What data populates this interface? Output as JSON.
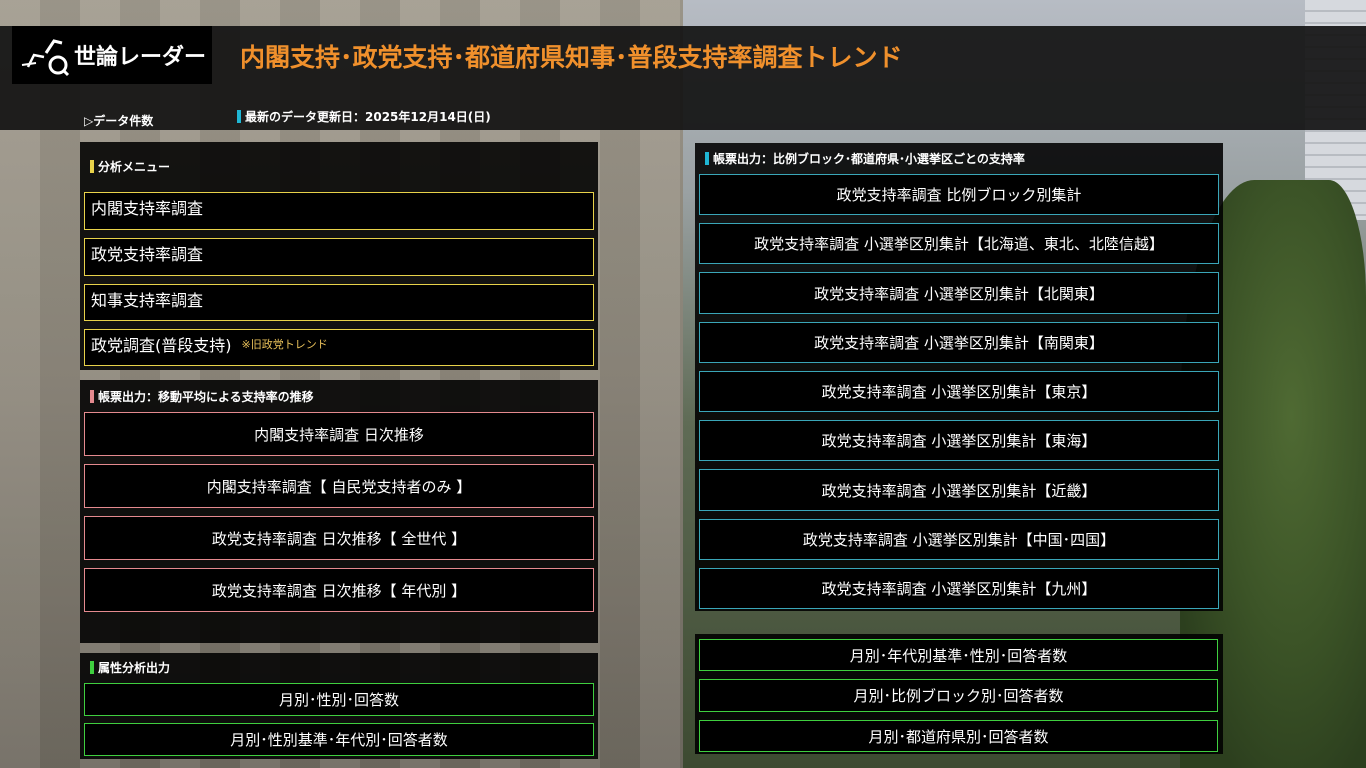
{
  "header": {
    "logo_text": "世論レーダー",
    "title": "内閣支持･政党支持･都道府県知事･普段支持率調査トレンド",
    "data_count": "▷データ件数",
    "update_date": "最新のデータ更新日：2025年12月14日(日)"
  },
  "menu": {
    "title": "分析メニュー",
    "items": [
      {
        "label": "内閣支持率調査"
      },
      {
        "label": "政党支持率調査"
      },
      {
        "label": "知事支持率調査"
      },
      {
        "label": "政党調査(普段支持)",
        "note": "※旧政党トレンド"
      }
    ]
  },
  "moving_avg": {
    "title": "帳票出力：移動平均による支持率の推移",
    "items": [
      "内閣支持率調査 日次推移",
      "内閣支持率調査【 自民党支持者のみ 】",
      "政党支持率調査 日次推移【 全世代 】",
      "政党支持率調査 日次推移【 年代別 】"
    ]
  },
  "attribute": {
    "title": "属性分析出力",
    "items": [
      "月別･性別･回答数",
      "月別･性別基準･年代別･回答者数"
    ]
  },
  "block": {
    "title": "帳票出力：比例ブロック･都道府県･小選挙区ごとの支持率",
    "items": [
      "政党支持率調査 比例ブロック別集計",
      "政党支持率調査 小選挙区別集計【北海道、東北、北陸信越】",
      "政党支持率調査 小選挙区別集計【北関東】",
      "政党支持率調査 小選挙区別集計【南関東】",
      "政党支持率調査 小選挙区別集計【東京】",
      "政党支持率調査 小選挙区別集計【東海】",
      "政党支持率調査 小選挙区別集計【近畿】",
      "政党支持率調査 小選挙区別集計【中国･四国】",
      "政党支持率調査 小選挙区別集計【九州】"
    ]
  },
  "respondents": {
    "items": [
      "月別･年代別基準･性別･回答者数",
      "月別･比例ブロック別･回答者数",
      "月別･都道府県別･回答者数"
    ]
  },
  "colors": {
    "title_orange": "#f0902c",
    "menu_yellow": "#e8d24a",
    "moving_pink": "#e58a8f",
    "attr_green": "#3fcf3f",
    "block_cyan": "#3aa6b8"
  }
}
